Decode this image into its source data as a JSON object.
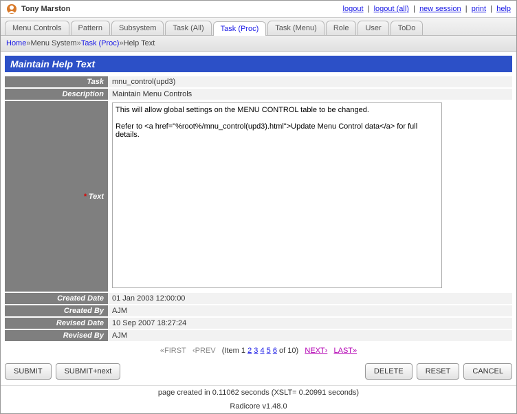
{
  "header": {
    "user_name": "Tony Marston",
    "links": {
      "logout": "logout",
      "logout_all": "logout (all)",
      "new_session": "new session",
      "print": "print",
      "help": "help"
    }
  },
  "tabs": [
    "Menu Controls",
    "Pattern",
    "Subsystem",
    "Task (All)",
    "Task (Proc)",
    "Task (Menu)",
    "Role",
    "User",
    "ToDo"
  ],
  "active_tab_index": 4,
  "breadcrumbs": {
    "home": "Home",
    "menu_system": "Menu System",
    "task_proc": "Task (Proc)",
    "help_text": "Help Text"
  },
  "page": {
    "title": "Maintain Help Text",
    "labels": {
      "task": "Task",
      "description": "Description",
      "text": "Text",
      "created_date": "Created Date",
      "created_by": "Created By",
      "revised_date": "Revised Date",
      "revised_by": "Revised By"
    },
    "values": {
      "task": "mnu_control(upd3)",
      "description": "Maintain Menu Controls",
      "text": "This will allow global settings on the MENU CONTROL table to be changed.\n\nRefer to <a href=\"%root%/mnu_control(upd3).html\">Update Menu Control data</a> for full details.",
      "created_date": "01 Jan 2003 12:00:00",
      "created_by": "AJM",
      "revised_date": "10 Sep 2007 18:27:24",
      "revised_by": "AJM"
    }
  },
  "pagination": {
    "first": "«FIRST",
    "prev": "‹PREV",
    "item_prefix": "(Item ",
    "current": 1,
    "pages": [
      "1",
      "2",
      "3",
      "4",
      "5",
      "6"
    ],
    "item_suffix": " of 10)",
    "next": "NEXT›",
    "last": "LAST»"
  },
  "buttons": {
    "submit": "SUBMIT",
    "submit_next": "SUBMIT+next",
    "delete": "DELETE",
    "reset": "RESET",
    "cancel": "CANCEL"
  },
  "footer": {
    "timing": "page created in 0.11062 seconds (XSLT= 0.20991 seconds)",
    "version": "Radicore v1.48.0"
  }
}
